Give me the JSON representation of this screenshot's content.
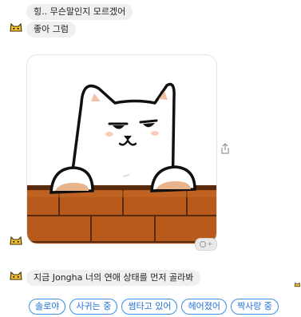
{
  "messages": {
    "m1": "힝.. 무슨말인지 모르겠어",
    "m2": "좋아 그럼",
    "m3": "지금 Jongha 너의 연애 상태를 먼저 골라봐"
  },
  "sticker": {
    "description_icon": "cat-on-brick-wall-sticker",
    "badge_icon": "reaction-add-icon",
    "badge_plus": "+"
  },
  "quick_replies": [
    {
      "label": "솔로야"
    },
    {
      "label": "사귀는 중"
    },
    {
      "label": "썸타고 있어"
    },
    {
      "label": "헤어졌어"
    },
    {
      "label": "짝사랑 중"
    }
  ],
  "colors": {
    "bubble": "#f1f0f0",
    "reply_border": "#3d8fe8",
    "avatar_yellow": "#f5c631",
    "brick": "#b85a1b"
  }
}
